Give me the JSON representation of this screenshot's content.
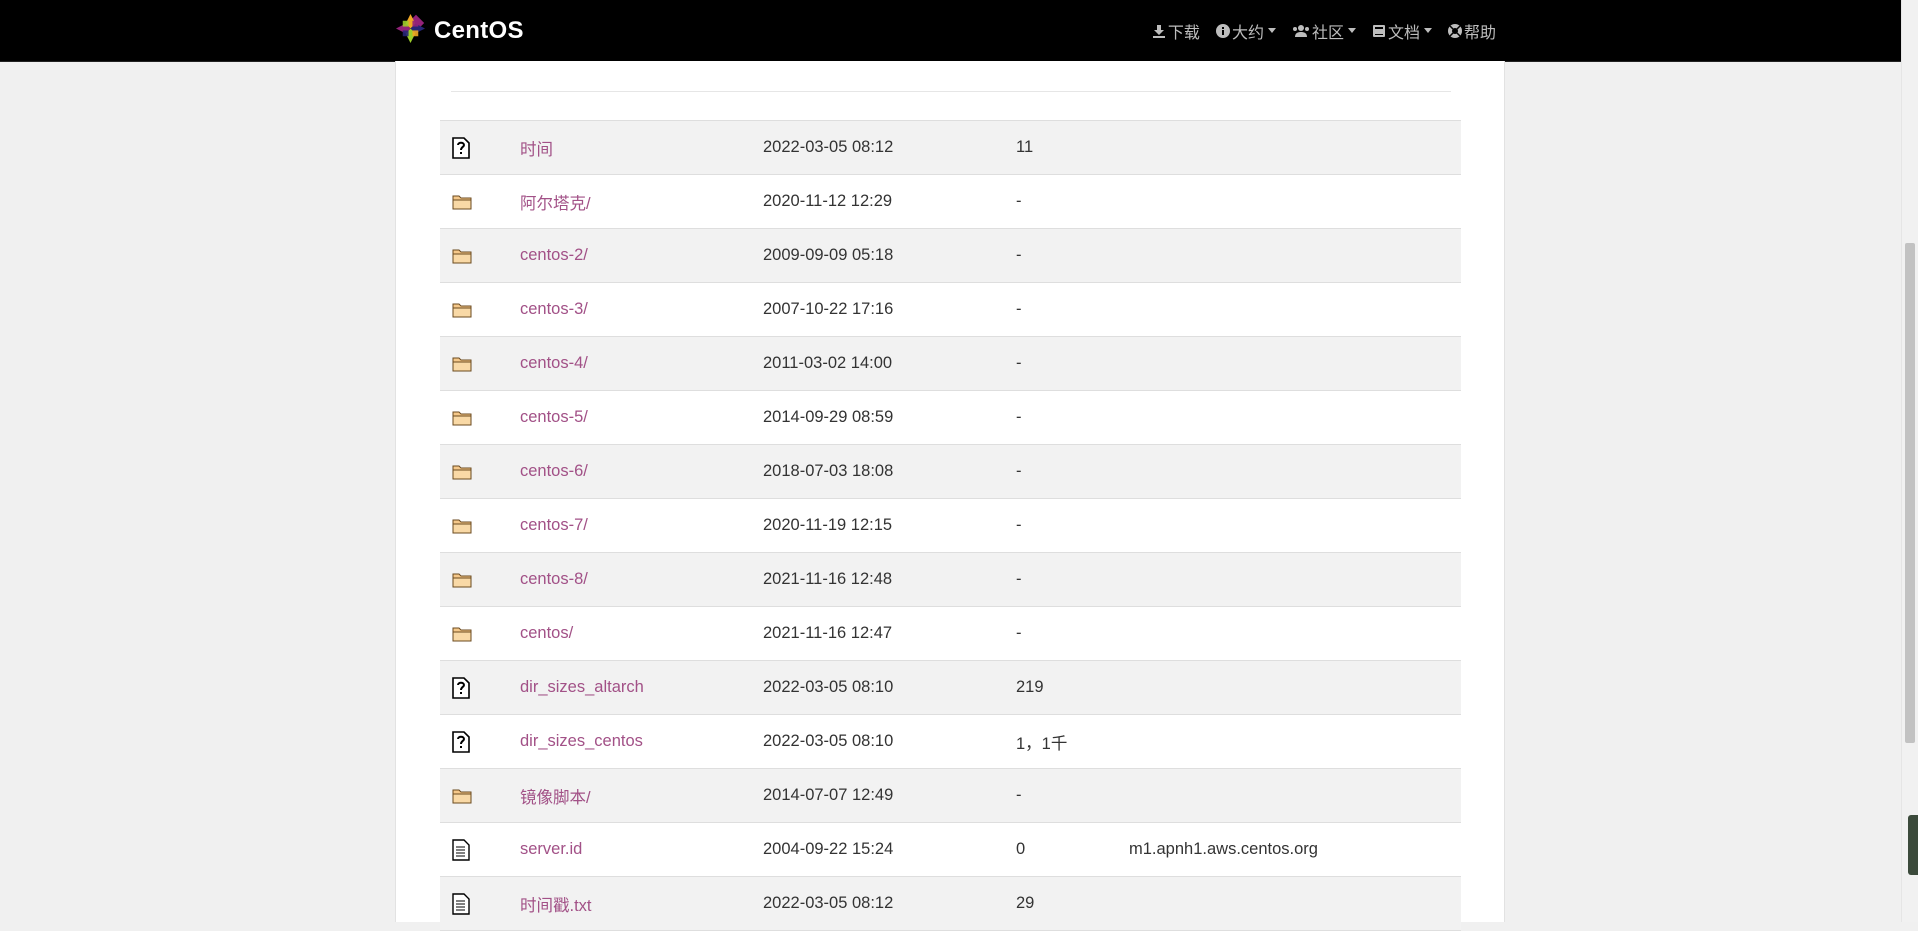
{
  "brand": {
    "name": "CentOS"
  },
  "nav": [
    {
      "icon": "download-icon",
      "label": "下载",
      "dropdown": false
    },
    {
      "icon": "info-icon",
      "label": "大约",
      "dropdown": true
    },
    {
      "icon": "users-icon",
      "label": "社区",
      "dropdown": true
    },
    {
      "icon": "book-icon",
      "label": "文档",
      "dropdown": true
    },
    {
      "icon": "help-circle-icon",
      "label": "帮助",
      "dropdown": false
    }
  ],
  "rows": [
    {
      "type": "unknown",
      "name": "时间",
      "date": "2022-03-05 08:12",
      "size": "11",
      "desc": ""
    },
    {
      "type": "folder",
      "name": "阿尔塔克/",
      "date": "2020-11-12 12:29",
      "size": "-",
      "desc": ""
    },
    {
      "type": "folder",
      "name": "centos-2/",
      "date": "2009-09-09 05:18",
      "size": "-",
      "desc": ""
    },
    {
      "type": "folder",
      "name": "centos-3/",
      "date": "2007-10-22 17:16",
      "size": "-",
      "desc": ""
    },
    {
      "type": "folder",
      "name": "centos-4/",
      "date": "2011-03-02 14:00",
      "size": "-",
      "desc": ""
    },
    {
      "type": "folder",
      "name": "centos-5/",
      "date": "2014-09-29 08:59",
      "size": "-",
      "desc": ""
    },
    {
      "type": "folder",
      "name": "centos-6/",
      "date": "2018-07-03 18:08",
      "size": "-",
      "desc": ""
    },
    {
      "type": "folder",
      "name": "centos-7/",
      "date": "2020-11-19 12:15",
      "size": "-",
      "desc": ""
    },
    {
      "type": "folder",
      "name": "centos-8/",
      "date": "2021-11-16 12:48",
      "size": "-",
      "desc": ""
    },
    {
      "type": "folder",
      "name": "centos/",
      "date": "2021-11-16 12:47",
      "size": "-",
      "desc": ""
    },
    {
      "type": "unknown",
      "name": "dir_sizes_altarch",
      "date": "2022-03-05 08:10",
      "size": "219",
      "desc": ""
    },
    {
      "type": "unknown",
      "name": "dir_sizes_centos",
      "date": "2022-03-05 08:10",
      "size": "1，1千",
      "desc": ""
    },
    {
      "type": "folder",
      "name": "镜像脚本/",
      "date": "2014-07-07 12:49",
      "size": "-",
      "desc": ""
    },
    {
      "type": "text",
      "name": "server.id",
      "date": "2004-09-22 15:24",
      "size": "0",
      "desc": "m1.apnh1.aws.centos.org"
    },
    {
      "type": "text",
      "name": "时间戳.txt",
      "date": "2022-03-05 08:12",
      "size": "29",
      "desc": ""
    }
  ],
  "colors": {
    "link": "#a25187",
    "navbar": "#000000",
    "row_stripe": "#f2f2f2"
  }
}
